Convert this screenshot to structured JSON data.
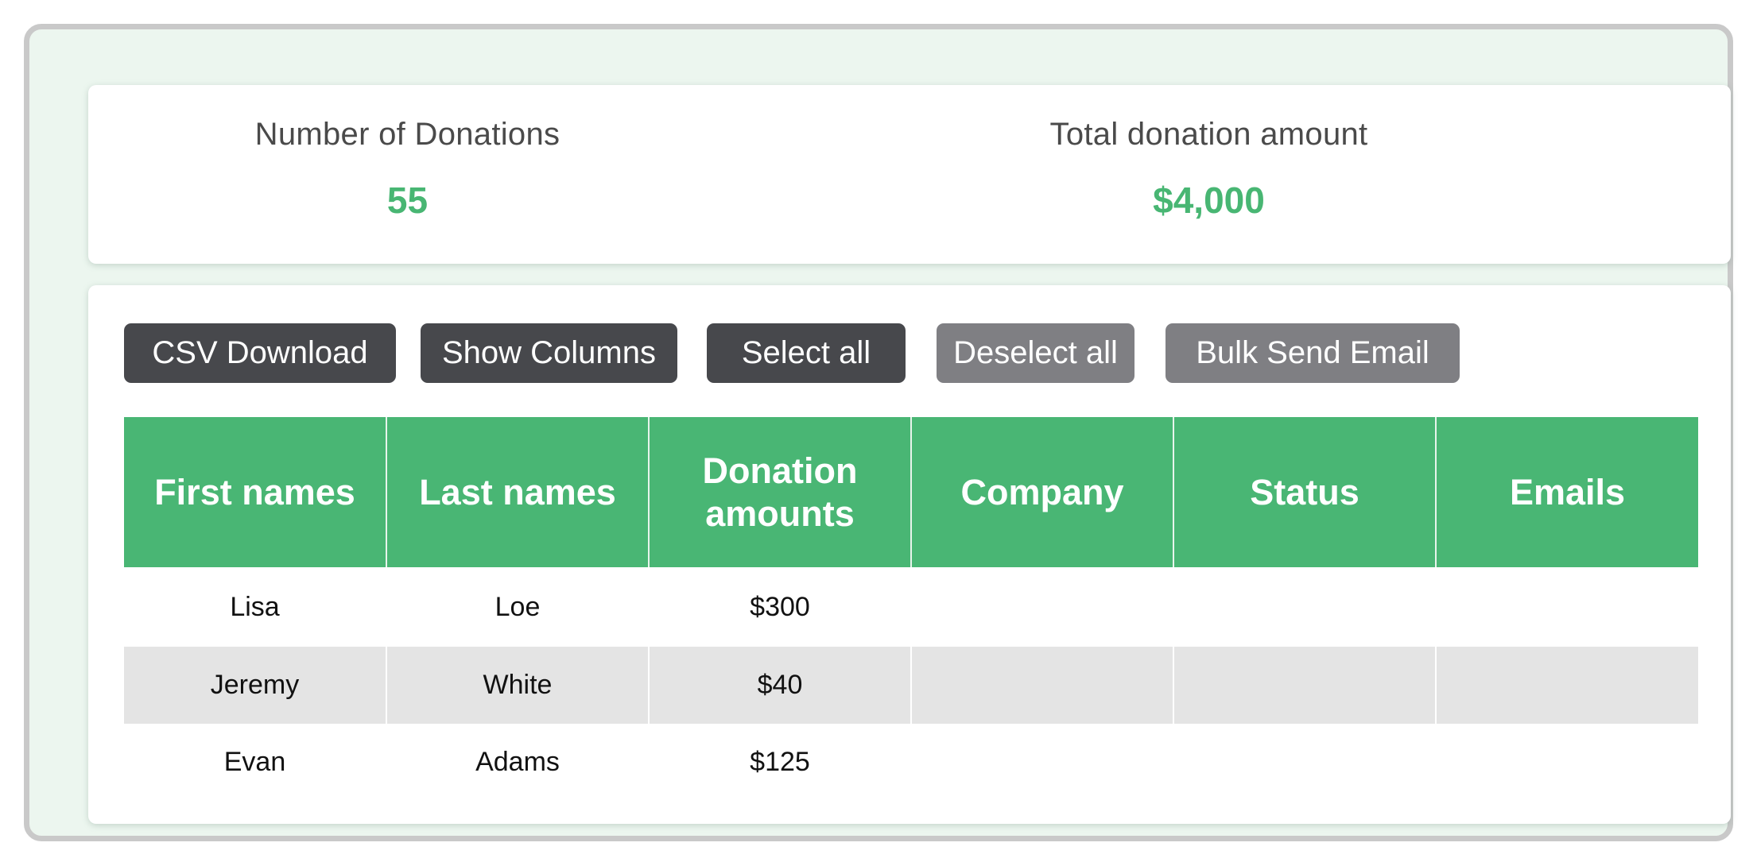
{
  "stats": {
    "donation_count_label": "Number of Donations",
    "donation_count_value": "55",
    "total_amount_label": "Total donation amount",
    "total_amount_value": "$4,000"
  },
  "toolbar": {
    "csv_download": "CSV Download",
    "show_columns": "Show Columns",
    "select_all": "Select all",
    "deselect_all": "Deselect all",
    "bulk_send_email": "Bulk Send Email"
  },
  "table": {
    "columns": [
      "First names",
      "Last names",
      "Donation amounts",
      "Company",
      "Status",
      "Emails"
    ],
    "rows": [
      [
        "Lisa",
        "Loe",
        "$300",
        "",
        "",
        ""
      ],
      [
        "Jeremy",
        "White",
        "$40",
        "",
        "",
        ""
      ],
      [
        "Evan",
        "Adams",
        "$125",
        "",
        "",
        ""
      ]
    ]
  },
  "colors": {
    "accent_green": "#49b674",
    "button_dark": "#47484c",
    "button_disabled": "#7f7f83",
    "frame_background": "#ecf6ef"
  }
}
